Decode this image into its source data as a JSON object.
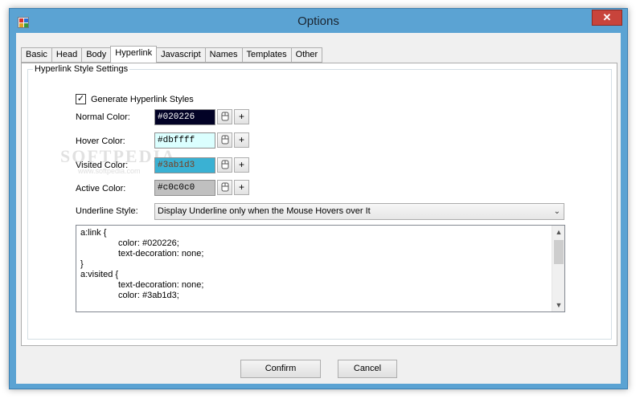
{
  "window": {
    "title": "Options",
    "close_label": "✕"
  },
  "tabs": [
    {
      "label": "Basic"
    },
    {
      "label": "Head"
    },
    {
      "label": "Body"
    },
    {
      "label": "Hyperlink"
    },
    {
      "label": "Javascript"
    },
    {
      "label": "Names"
    },
    {
      "label": "Templates"
    },
    {
      "label": "Other"
    }
  ],
  "active_tab": "Hyperlink",
  "group": {
    "title": "Hyperlink Style Settings",
    "generate_label": "Generate Hyperlink Styles",
    "generate_checked": true
  },
  "colors": {
    "normal": {
      "label": "Normal Color:",
      "value": "#020226",
      "bg": "#020226",
      "fg": "#ffffff"
    },
    "hover": {
      "label": "Hover Color:",
      "value": "#dbffff",
      "bg": "#dbffff",
      "fg": "#000000"
    },
    "visited": {
      "label": "Visited Color:",
      "value": "#3ab1d3",
      "bg": "#3ab1d3",
      "fg": "#7a3a1a"
    },
    "active": {
      "label": "Active Color:",
      "value": "#c0c0c0",
      "bg": "#c0c0c0",
      "fg": "#000000"
    }
  },
  "plus_label": "+",
  "underline": {
    "label": "Underline Style:",
    "value": "Display Underline only when the Mouse Hovers over It"
  },
  "code_lines": [
    {
      "text": "a:link {",
      "indent": false
    },
    {
      "text": "color: #020226;",
      "indent": true
    },
    {
      "text": "text-decoration: none;",
      "indent": true
    },
    {
      "text": "}",
      "indent": false
    },
    {
      "text": "a:visited {",
      "indent": false
    },
    {
      "text": "text-decoration: none;",
      "indent": true
    },
    {
      "text": "color: #3ab1d3;",
      "indent": true
    }
  ],
  "buttons": {
    "confirm": "Confirm",
    "cancel": "Cancel"
  },
  "watermark": {
    "text": "SOFTPEDIA",
    "url": "www.softpedia.com"
  }
}
